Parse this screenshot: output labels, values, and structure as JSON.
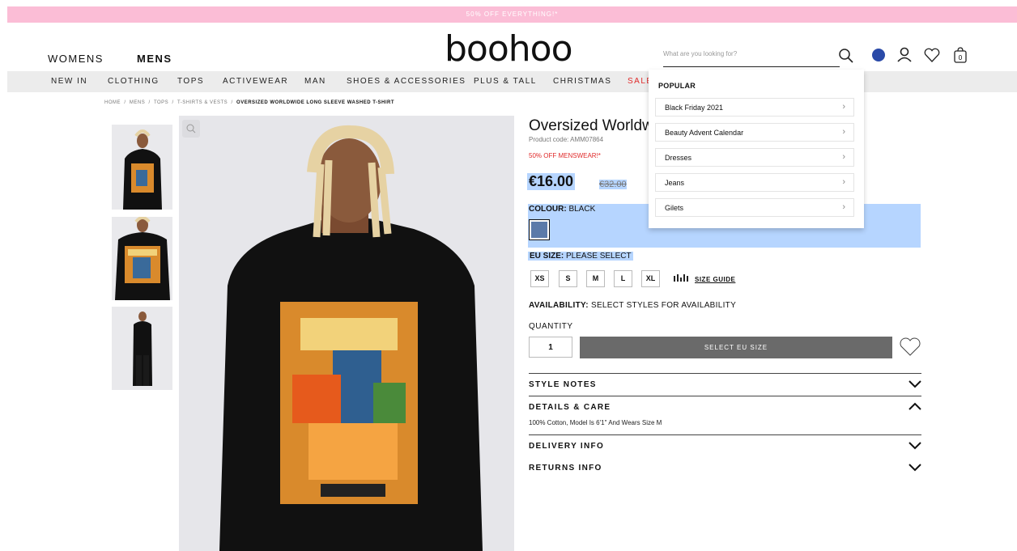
{
  "promo": "50% OFF EVERYTHING!*",
  "header": {
    "genders": [
      "WOMENS",
      "MENS"
    ],
    "logo": "boohoo",
    "search_placeholder": "What are you looking for?",
    "bag_count": "0"
  },
  "nav": [
    "NEW IN",
    "CLOTHING",
    "TOPS",
    "ACTIVEWEAR",
    "MAN",
    "SHOES & ACCESSORIES",
    "PLUS & TALL",
    "CHRISTMAS",
    "SALE"
  ],
  "breadcrumb": {
    "items": [
      "HOME",
      "MENS",
      "TOPS",
      "T-SHIRTS & VESTS"
    ],
    "separator": "/",
    "current": "OVERSIZED WORLDWIDE LONG SLEEVE WASHED T-SHIRT"
  },
  "product": {
    "title": "Oversized Worldw",
    "code": "Product code: AMM07864",
    "offer": "50% OFF MENSWEAR!*",
    "price": "€16.00",
    "was_price": "€32.00",
    "colour_label": "COLOUR:",
    "colour_value": "BLACK",
    "size_label": "EU SIZE:",
    "size_value": "PLEASE SELECT",
    "sizes": [
      "XS",
      "S",
      "M",
      "L",
      "XL"
    ],
    "size_guide": "SIZE GUIDE",
    "availability_label": "AVAILABILITY:",
    "availability_value": "SELECT STYLES FOR AVAILABILITY",
    "quantity_label": "QUANTITY",
    "quantity": "1",
    "add_button": "SELECT EU SIZE",
    "accordions": [
      "STYLE NOTES",
      "DETAILS & CARE",
      "DELIVERY INFO",
      "RETURNS INFO"
    ],
    "details_text": "100% Cotton, Model Is 6'1\" And Wears Size M"
  },
  "popular": {
    "heading": "POPULAR",
    "items": [
      "Black Friday 2021",
      "Beauty Advent Calendar",
      "Dresses",
      "Jeans",
      "Gilets"
    ]
  },
  "colors": {
    "promo": "#fbbdd6",
    "highlight": "#b6d5ff",
    "sale": "#e02a2a",
    "swatch": "#5b7aa9",
    "button": "#6a6a6a"
  }
}
